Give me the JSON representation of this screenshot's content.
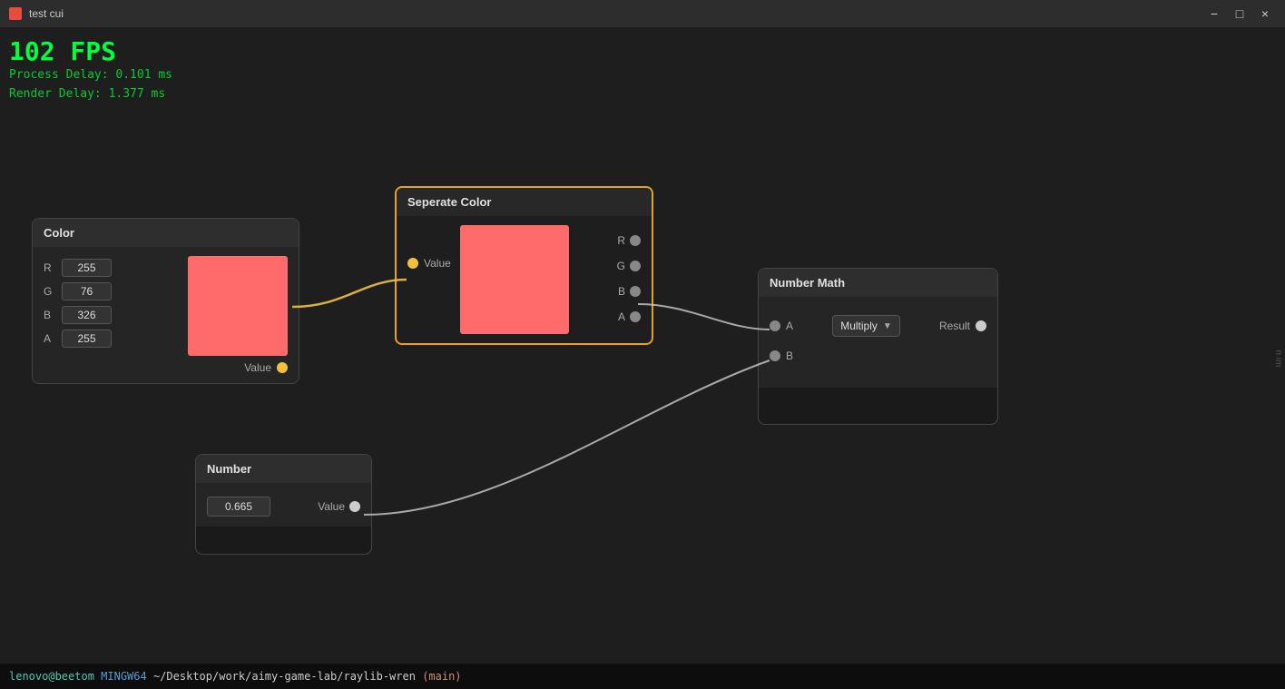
{
  "titlebar": {
    "icon_color": "#e74c3c",
    "title": "test cui",
    "minimize_label": "−",
    "maximize_label": "□",
    "close_label": "×"
  },
  "fps": {
    "value": "102 FPS",
    "process_delay": "Process Delay: 0.101 ms",
    "render_delay": "Render Delay: 1.377 ms"
  },
  "color_node": {
    "title": "Color",
    "r_label": "R",
    "g_label": "G",
    "b_label": "B",
    "a_label": "A",
    "r_value": "255",
    "g_value": "76",
    "b_value": "326",
    "a_value": "255",
    "output_label": "Value"
  },
  "separate_node": {
    "title": "Seperate Color",
    "input_label": "Value",
    "r_label": "R",
    "g_label": "G",
    "b_label": "B",
    "a_label": "A"
  },
  "math_node": {
    "title": "Number Math",
    "a_label": "A",
    "b_label": "B",
    "operation": "Multiply",
    "result_label": "Result"
  },
  "number_node": {
    "title": "Number",
    "value": "0.665",
    "output_label": "Value"
  },
  "terminal": {
    "user": "lenovo@beetom",
    "space": " ",
    "dir": "MINGW64",
    "path": " ~/Desktop/work/aimy-game-lab/raylib-wren",
    "branch": " (main)"
  }
}
